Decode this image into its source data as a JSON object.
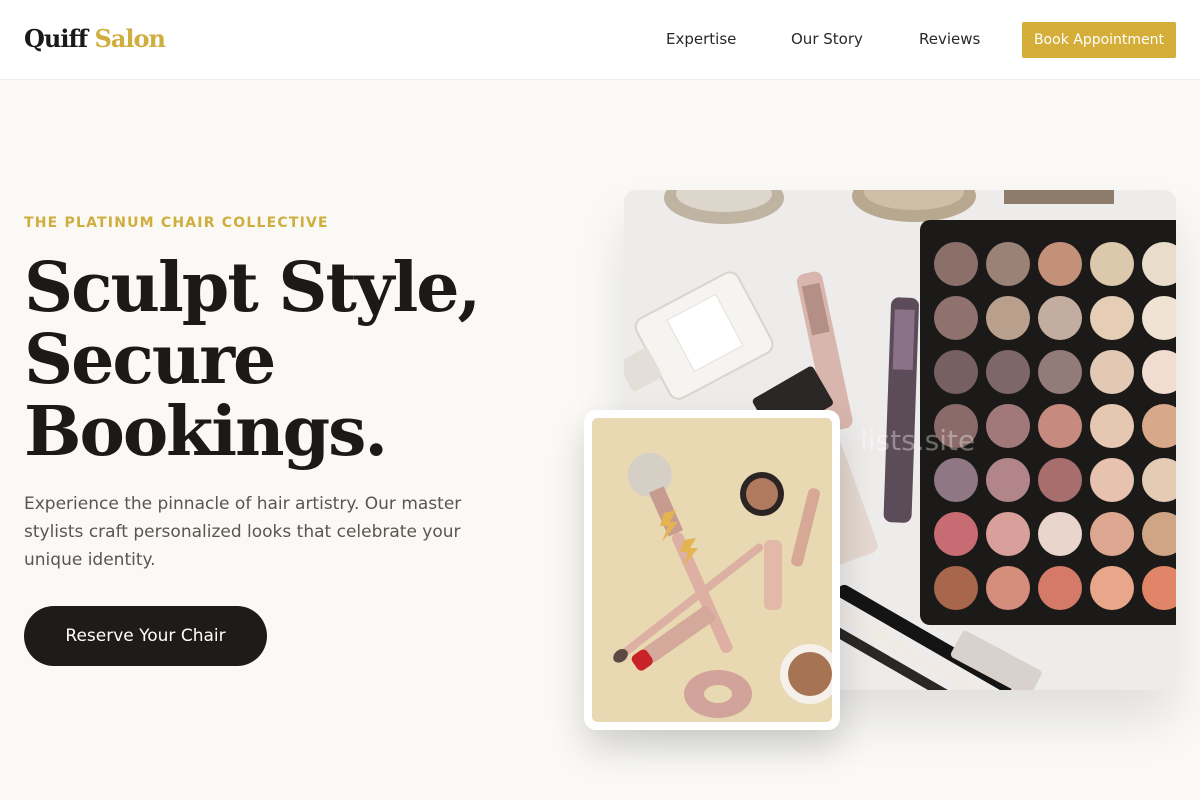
{
  "header": {
    "logo_part1": "Quiff",
    "logo_part2": "Salon",
    "nav": [
      "Expertise",
      "Our Story",
      "Reviews"
    ],
    "cta": "Book Appointment"
  },
  "hero": {
    "eyebrow": "THE PLATINUM CHAIR COLLECTIVE",
    "title_lines": [
      "Sculpt Style,",
      "Secure",
      "Bookings."
    ],
    "subtitle": "Experience the pinnacle of hair artistry. Our master stylists craft personalized looks that celebrate your unique identity.",
    "cta": "Reserve Your Chair"
  },
  "images": {
    "main_alt": "Makeup palette with eyeshadows, perfume and lip products",
    "secondary_alt": "Makeup brushes, lipstick and compact on beige background",
    "watermark": "lists.site"
  },
  "colors": {
    "accent": "#d4ae38",
    "dark": "#1f1b19",
    "background": "#faf9f6"
  }
}
